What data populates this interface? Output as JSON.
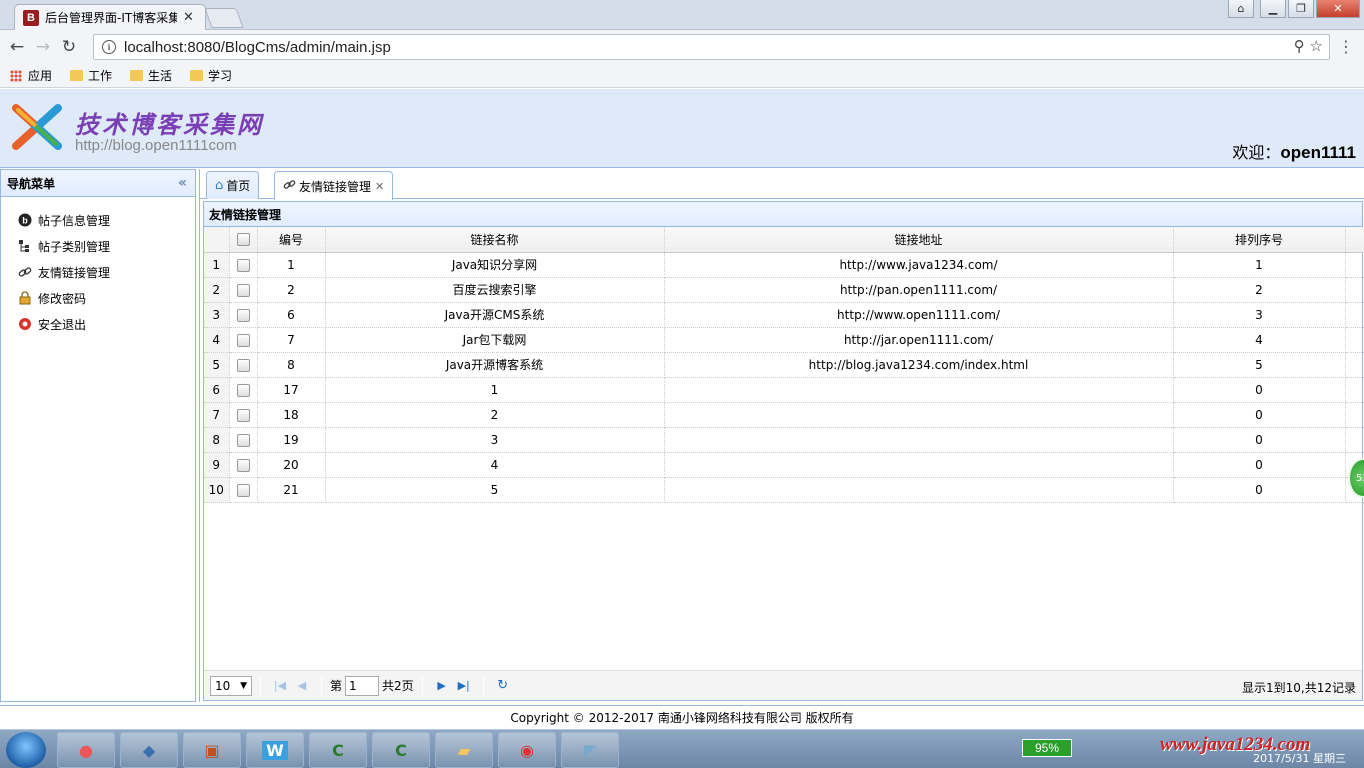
{
  "browser": {
    "tab_title": "后台管理界面-IT博客采集",
    "tab_favicon": "B",
    "url": "localhost:8080/BlogCms/admin/main.jsp",
    "bookmarks": [
      "应用",
      "工作",
      "生活",
      "学习"
    ]
  },
  "header": {
    "site_title": "技术博客采集网",
    "site_url": "http://blog.open1111com",
    "welcome_label": "欢迎：",
    "username": "open1111"
  },
  "nav": {
    "title": "导航菜单",
    "items": [
      {
        "label": "帖子信息管理",
        "icon": "blog-icon"
      },
      {
        "label": "帖子类别管理",
        "icon": "tree-icon"
      },
      {
        "label": "友情链接管理",
        "icon": "link-icon"
      },
      {
        "label": "修改密码",
        "icon": "lock-icon"
      },
      {
        "label": "安全退出",
        "icon": "exit-icon"
      }
    ]
  },
  "tabs": [
    {
      "label": "首页",
      "icon": "home-icon"
    },
    {
      "label": "友情链接管理",
      "icon": "link-icon",
      "closable": true
    }
  ],
  "panel": {
    "title": "友情链接管理"
  },
  "table": {
    "columns": [
      "编号",
      "链接名称",
      "链接地址",
      "排列序号"
    ],
    "rows": [
      {
        "n": "1",
        "id": "1",
        "name": "Java知识分享网",
        "url": "http://www.java1234.com/",
        "order": "1"
      },
      {
        "n": "2",
        "id": "2",
        "name": "百度云搜索引擎",
        "url": "http://pan.open1111.com/",
        "order": "2"
      },
      {
        "n": "3",
        "id": "6",
        "name": "Java开源CMS系统",
        "url": "http://www.open1111.com/",
        "order": "3"
      },
      {
        "n": "4",
        "id": "7",
        "name": "Jar包下载网",
        "url": "http://jar.open1111.com/",
        "order": "4"
      },
      {
        "n": "5",
        "id": "8",
        "name": "Java开源博客系统",
        "url": "http://blog.java1234.com/index.html",
        "order": "5"
      },
      {
        "n": "6",
        "id": "17",
        "name": "1",
        "url": "",
        "order": "0"
      },
      {
        "n": "7",
        "id": "18",
        "name": "2",
        "url": "",
        "order": "0"
      },
      {
        "n": "8",
        "id": "19",
        "name": "3",
        "url": "",
        "order": "0"
      },
      {
        "n": "9",
        "id": "20",
        "name": "4",
        "url": "",
        "order": "0"
      },
      {
        "n": "10",
        "id": "21",
        "name": "5",
        "url": "",
        "order": "0"
      }
    ]
  },
  "pager": {
    "page_size": "10",
    "page_prefix": "第",
    "page_value": "1",
    "page_total": "共2页",
    "info": "显示1到10,共12记录"
  },
  "footer": {
    "copyright": "Copyright © 2012-2017 南通小锋网络科技有限公司 版权所有"
  },
  "taskbar": {
    "battery": "95%",
    "date": "2017/5/31 星期三",
    "watermark": "www.java1234.com",
    "bubble": "52"
  }
}
